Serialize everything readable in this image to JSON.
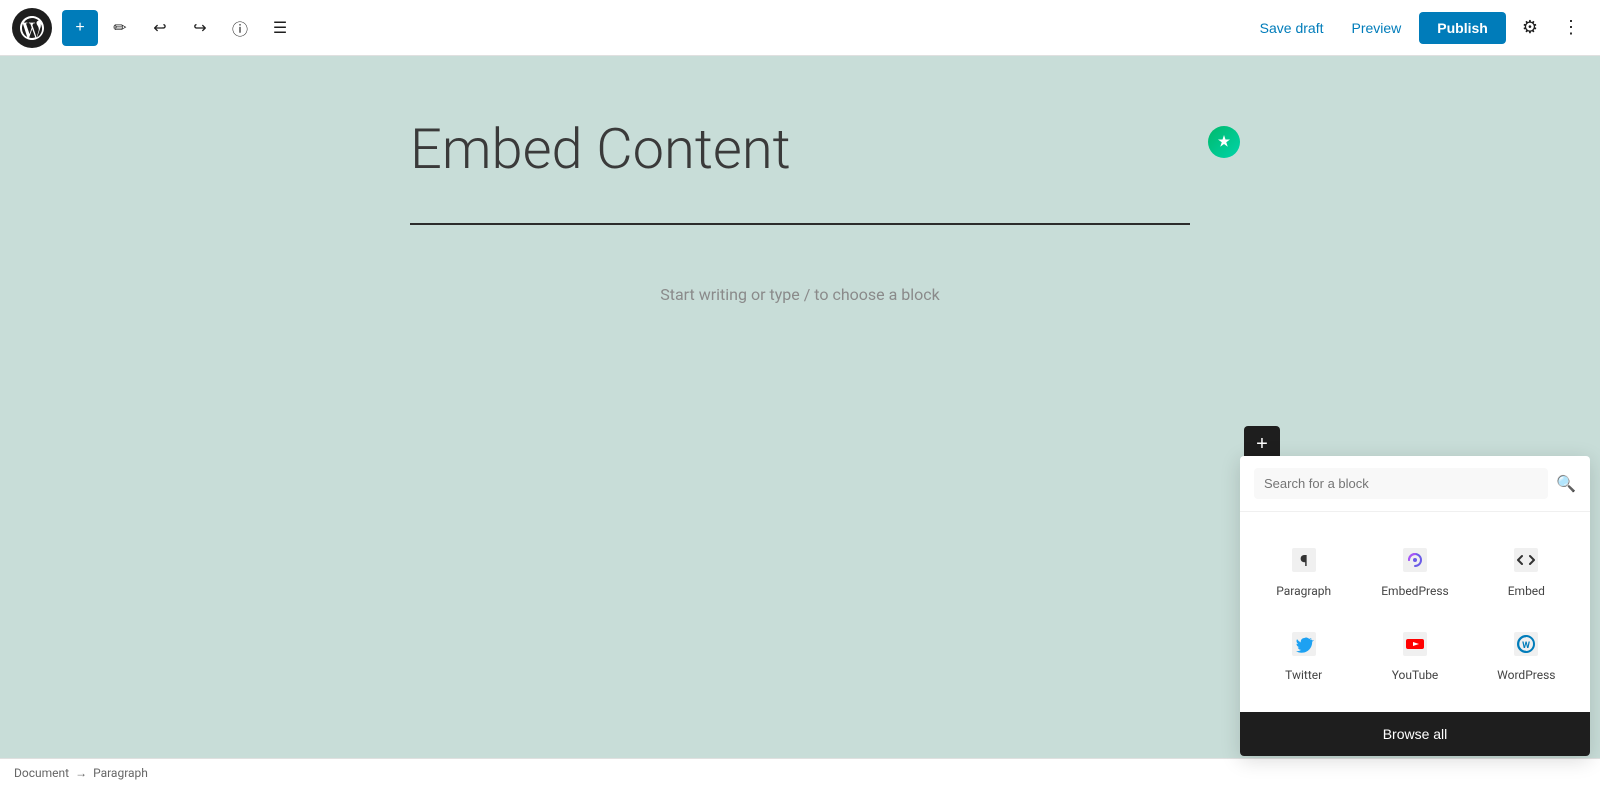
{
  "toolbar": {
    "wp_logo_alt": "WordPress",
    "add_button_label": "+",
    "tools_icon": "pencil",
    "undo_icon": "undo",
    "redo_icon": "redo",
    "info_icon": "info",
    "list_view_icon": "list",
    "save_draft_label": "Save draft",
    "preview_label": "Preview",
    "publish_label": "Publish",
    "settings_icon": "gear",
    "more_icon": "ellipsis"
  },
  "editor": {
    "post_title": "Embed Content",
    "placeholder_text": "Start writing or type / to choose a block",
    "grammarly_alt": "Grammarly"
  },
  "block_picker": {
    "search_placeholder": "Search for a block",
    "search_icon": "🔍",
    "blocks": [
      {
        "id": "paragraph",
        "label": "Paragraph",
        "icon": "¶",
        "type": "paragraph"
      },
      {
        "id": "embedpress",
        "label": "EmbedPress",
        "icon": "∞",
        "type": "embedpress"
      },
      {
        "id": "embed",
        "label": "Embed",
        "icon": "embed",
        "type": "embed"
      },
      {
        "id": "twitter",
        "label": "Twitter",
        "icon": "twitter",
        "type": "twitter"
      },
      {
        "id": "youtube",
        "label": "YouTube",
        "icon": "youtube",
        "type": "youtube"
      },
      {
        "id": "wordpress",
        "label": "WordPress",
        "icon": "wordpress",
        "type": "wordpress"
      }
    ],
    "browse_all_label": "Browse all"
  },
  "status_bar": {
    "breadcrumb": "Document",
    "separator": "→",
    "context": "Paragraph"
  }
}
